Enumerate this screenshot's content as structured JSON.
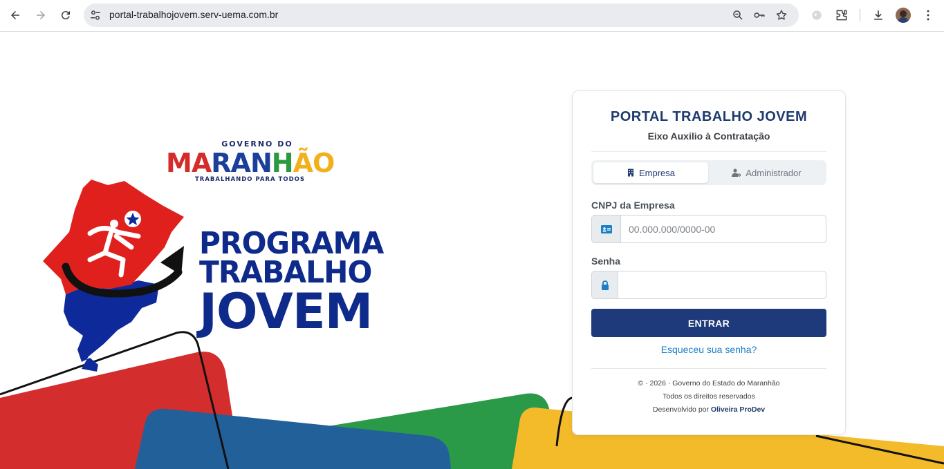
{
  "browser": {
    "url": "portal-trabalhojovem.serv-uema.com.br"
  },
  "branding": {
    "gov_top": "GOVERNO DO",
    "gov_letters": [
      {
        "ch": "M",
        "color": "#d62b2b"
      },
      {
        "ch": "A",
        "color": "#d62b2b"
      },
      {
        "ch": "R",
        "color": "#1b3f9a"
      },
      {
        "ch": "A",
        "color": "#1b3f9a"
      },
      {
        "ch": "N",
        "color": "#1b3f9a"
      },
      {
        "ch": "H",
        "color": "#2b9a3f"
      },
      {
        "ch": "Ã",
        "color": "#f2b11c"
      },
      {
        "ch": "O",
        "color": "#f2b11c"
      }
    ],
    "gov_sub": "TRABALHANDO PARA TODOS",
    "program_line1": "PROGRAMA",
    "program_line2": "TRABALHO",
    "program_line3": "JOVEM",
    "colors": {
      "red": "#d42d2d",
      "blue": "#22609a",
      "green": "#2a9a48",
      "yellow": "#f3bb2a",
      "navy": "#0e2a8a"
    }
  },
  "login": {
    "title": "PORTAL TRABALHO JOVEM",
    "subtitle": "Eixo Auxilio à Contratação",
    "tabs": [
      {
        "label": "Empresa",
        "icon": "building-icon",
        "active": true
      },
      {
        "label": "Administrador",
        "icon": "user-cog-icon",
        "active": false
      }
    ],
    "cnpj_label": "CNPJ da Empresa",
    "cnpj_placeholder": "00.000.000/0000-00",
    "cnpj_value": "",
    "senha_label": "Senha",
    "senha_value": "",
    "submit_label": "ENTRAR",
    "forgot_label": "Esqueceu sua senha?",
    "footer_line1": "© · 2026 · Governo do Estado do Maranhão",
    "footer_line2": "Todos os direitos reservados",
    "footer_line3_prefix": "Desenvolvido por",
    "footer_line3_brand": "Oliveira ProDev",
    "accent_color": "#1e3a7a",
    "link_color": "#1a7fc4"
  }
}
